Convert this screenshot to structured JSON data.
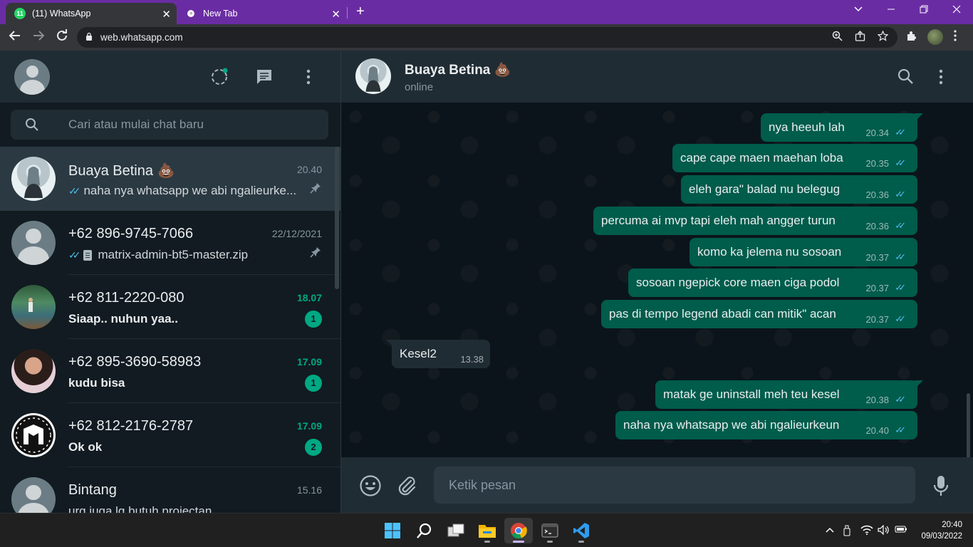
{
  "browser": {
    "tabs": [
      {
        "title": "(11) WhatsApp",
        "badge": "11"
      },
      {
        "title": "New Tab"
      }
    ],
    "url": "web.whatsapp.com"
  },
  "sidebar": {
    "search_placeholder": "Cari atau mulai chat baru",
    "chats": [
      {
        "name": "Buaya Betina 💩",
        "time": "20.40",
        "preview": "naha nya whatsapp we abi ngalieurke...",
        "pinned": true,
        "read": true
      },
      {
        "name": "+62 896-9745-7066",
        "time": "22/12/2021",
        "preview": "matrix-admin-bt5-master.zip",
        "pinned": true,
        "read": true,
        "attachment": true
      },
      {
        "name": "+62 811-2220-080",
        "time": "18.07",
        "preview": "Siaap.. nuhun yaa..",
        "unread": "1"
      },
      {
        "name": "+62 895-3690-58983",
        "time": "17.09",
        "preview": "kudu bisa",
        "unread": "1"
      },
      {
        "name": "+62 812-2176-2787",
        "time": "17.09",
        "preview": "Ok ok",
        "unread": "2"
      },
      {
        "name": "Bintang",
        "time": "15.16",
        "preview": "urg juga lg butuh projectan"
      }
    ]
  },
  "conversation": {
    "name": "Buaya Betina 💩",
    "status": "online",
    "messages": [
      {
        "dir": "out",
        "text": "nya heeuh lah",
        "time": "20.34"
      },
      {
        "dir": "out",
        "text": "cape cape maen maehan loba",
        "time": "20.35"
      },
      {
        "dir": "out",
        "text": "eleh gara\" balad nu belegug",
        "time": "20.36"
      },
      {
        "dir": "out",
        "text": "percuma ai mvp tapi eleh mah angger turun",
        "time": "20.36"
      },
      {
        "dir": "out",
        "text": "komo ka jelema nu sosoan",
        "time": "20.37"
      },
      {
        "dir": "out",
        "text": "sosoan ngepick core maen ciga podol",
        "time": "20.37"
      },
      {
        "dir": "out",
        "text": "pas di tempo legend abadi can mitik\" acan",
        "time": "20.37"
      },
      {
        "dir": "in",
        "text": "Kesel2",
        "time": "13.38"
      },
      {
        "dir": "out",
        "text": "matak ge uninstall meh teu kesel",
        "time": "20.38"
      },
      {
        "dir": "out",
        "text": "naha nya whatsapp we abi ngalieurkeun",
        "time": "20.40"
      }
    ],
    "input_placeholder": "Ketik pesan"
  },
  "taskbar": {
    "time": "20:40",
    "date": "09/03/2022"
  },
  "colors": {
    "accent": "#00a884",
    "outgoing_bubble": "#005c4b",
    "incoming_bubble": "#202c33",
    "read_ticks": "#53bdeb",
    "tab_strip": "#6a2ca3"
  }
}
